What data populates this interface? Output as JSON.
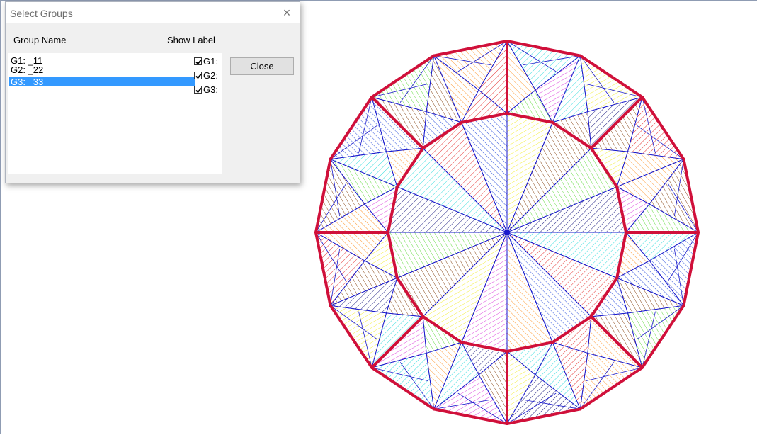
{
  "dialog": {
    "title": "Select Groups",
    "close_glyph": "×",
    "col_group_name": "Group Name",
    "col_show_label": "Show Label",
    "groups": [
      {
        "label": "G1: _11",
        "selected": false
      },
      {
        "label": "G2: _22",
        "selected": false
      },
      {
        "label": "G3: _33",
        "selected": true
      }
    ],
    "show_labels": [
      {
        "label": "G1:",
        "checked": true
      },
      {
        "label": "G2:",
        "checked": true
      },
      {
        "label": "G3:",
        "checked": true
      }
    ],
    "close_button": "Close"
  },
  "gem": {
    "facet_outline_color": "#d0103a",
    "line_color": "#1a1acc",
    "hatch_colors": [
      "#e53030",
      "#ff9933",
      "#f2ee3a",
      "#66dd44",
      "#33dddd",
      "#3355dd",
      "#dd44dd",
      "#8a4a1a",
      "#1a1a80"
    ]
  }
}
